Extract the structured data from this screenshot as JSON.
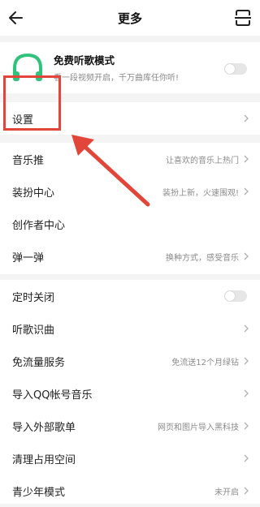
{
  "header": {
    "title": "更多",
    "back_icon": "back-arrow-icon",
    "scan_icon": "scan-icon"
  },
  "free_mode": {
    "title": "免费听歌模式",
    "subtitle": "看一段视频开启，千万曲库任你听!",
    "icon": "headphones-icon",
    "toggle_on": false
  },
  "settings": {
    "label": "设置"
  },
  "group1": [
    {
      "label": "音乐推",
      "value": "让喜欢的音乐上热门"
    },
    {
      "label": "装扮中心",
      "value": "装扮上新，火速围观!"
    },
    {
      "label": "创作者中心",
      "value": ""
    },
    {
      "label": "弹一弹",
      "value": "换种方式，感受音乐"
    }
  ],
  "group2": [
    {
      "label": "定时关闭",
      "value": "",
      "toggle_on": false
    },
    {
      "label": "听歌识曲",
      "value": ""
    },
    {
      "label": "免流量服务",
      "value": "免流送12个月绿钻"
    },
    {
      "label": "导入QQ帐号音乐",
      "value": ""
    },
    {
      "label": "导入外部歌单",
      "value": "网页和图片导入黑科技"
    },
    {
      "label": "清理占用空间",
      "value": ""
    },
    {
      "label": "青少年模式",
      "value": "未开启"
    }
  ],
  "colors": {
    "accent_green": "#31c27c",
    "annotation_red": "#e2463a",
    "background": "#f4f4f4"
  }
}
